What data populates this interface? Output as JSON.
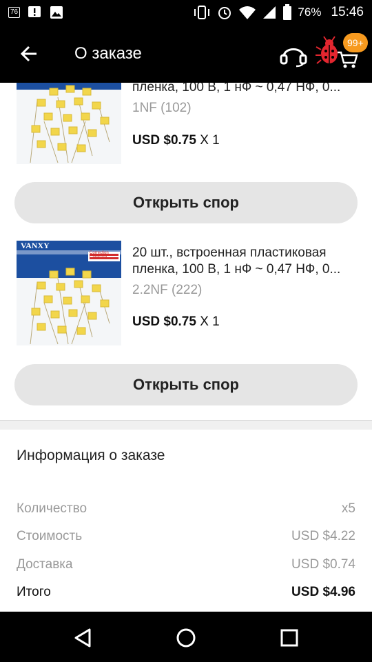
{
  "status_bar": {
    "notification_badge": "76",
    "battery": "76%",
    "time": "15:46"
  },
  "app_bar": {
    "title": "О заказе",
    "cart_badge": "99+"
  },
  "products": [
    {
      "name_lines": [
        "пленка, 100 В, 1 нФ ~ 0,47 НФ, 0..."
      ],
      "variant": "1NF (102)",
      "price": "USD $0.75",
      "qty": "X 1",
      "dispute_label": "Открыть спор"
    },
    {
      "name_lines": [
        "20 шт., встроенная пластиковая",
        "пленка, 100 В, 1 нФ ~ 0,47 НФ, 0..."
      ],
      "variant": "2.2NF (222)",
      "price": "USD $0.75",
      "qty": "X 1",
      "dispute_label": "Открыть спор",
      "image_brand": "VANXY",
      "image_tag": "Correction Capacitor"
    }
  ],
  "order_info": {
    "title": "Информация о заказе",
    "rows": [
      {
        "label": "Количество",
        "value": "x5"
      },
      {
        "label": "Стоимость",
        "value": "USD $4.22"
      },
      {
        "label": "Доставка",
        "value": "USD $0.74"
      },
      {
        "label": "Итого",
        "value": "USD $4.96"
      }
    ]
  },
  "colors": {
    "badge": "#f79a1f",
    "bug": "#e3262f",
    "button_bg": "#e5e5e5",
    "product_bg": "#1c4fa0",
    "capacitor": "#f2d64b"
  }
}
